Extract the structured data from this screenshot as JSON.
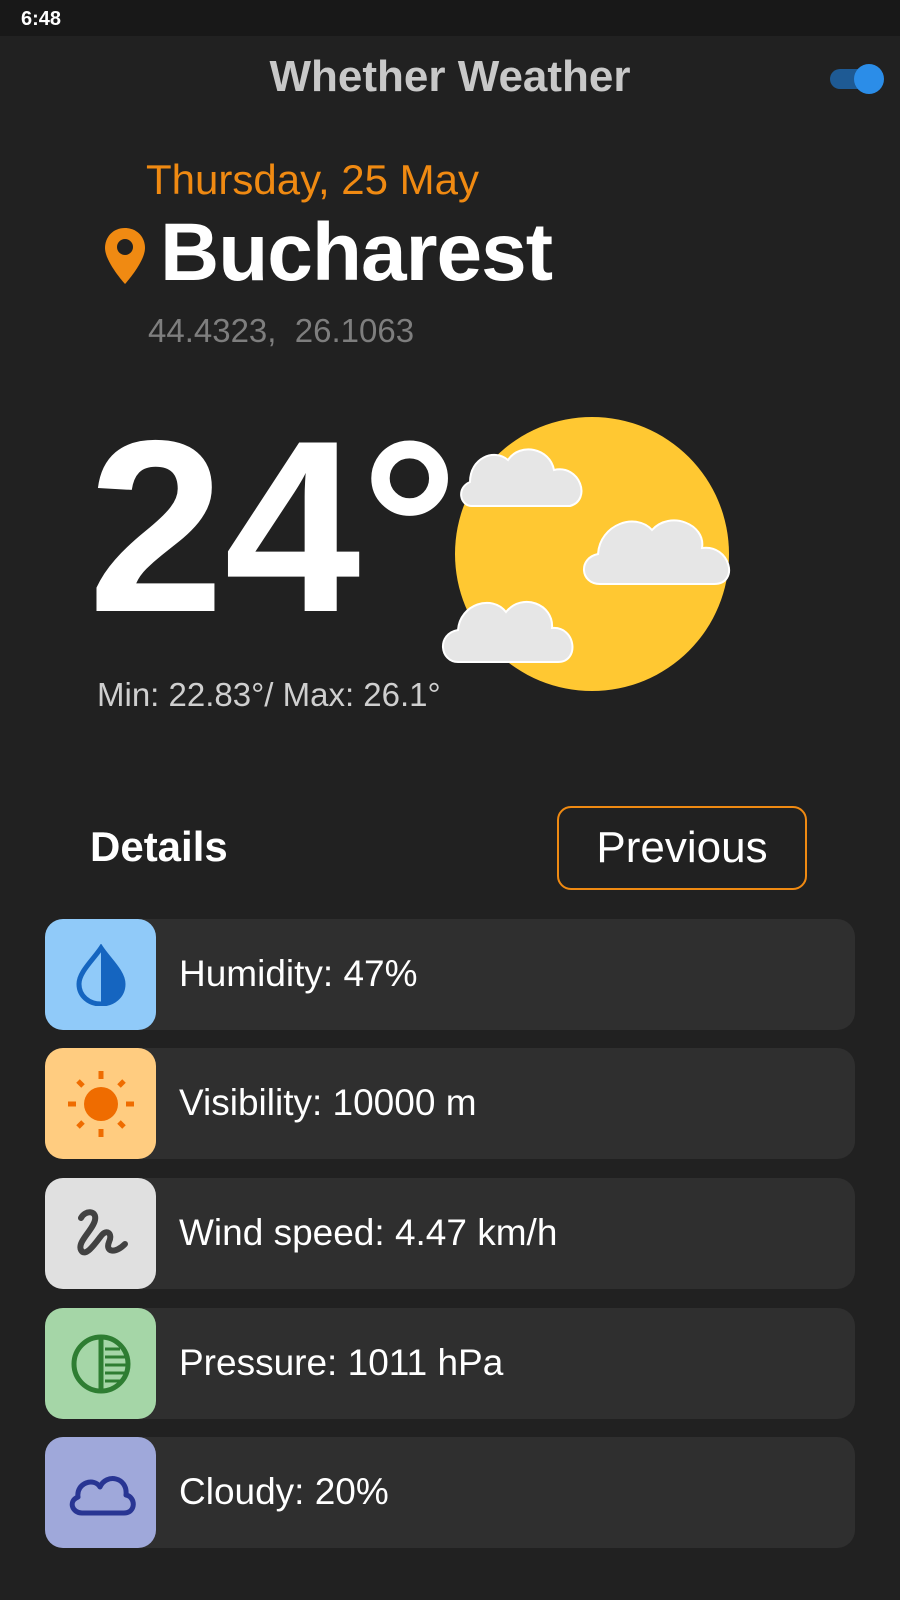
{
  "status_bar": {
    "time": "6:48"
  },
  "header": {
    "title": "Whether Weather",
    "toggle_on": true
  },
  "location": {
    "date": "Thursday, 25 May",
    "city": "Bucharest",
    "coordinates": "44.4323,  26.1063"
  },
  "current": {
    "temperature": "24°",
    "minmax": "Min: 22.83°/ Max: 26.1°",
    "condition_icon": "sun-with-clouds-icon"
  },
  "details": {
    "label": "Details",
    "previous_button": "Previous",
    "items": [
      {
        "label": "Humidity: 47%",
        "icon": "water-drop-icon",
        "icon_bg": "#90caf9",
        "icon_color": "#1565c0"
      },
      {
        "label": "Visibility: 10000 m",
        "icon": "sun-icon",
        "icon_bg": "#ffcc80",
        "icon_color": "#ef6c00"
      },
      {
        "label": "Wind speed: 4.47 km/h",
        "icon": "wind-squiggle-icon",
        "icon_bg": "#e0e0e0",
        "icon_color": "#424242"
      },
      {
        "label": "Pressure: 1011 hPa",
        "icon": "pressure-gauge-icon",
        "icon_bg": "#a5d6a7",
        "icon_color": "#2e7d32"
      },
      {
        "label": "Cloudy: 20%",
        "icon": "cloud-icon",
        "icon_bg": "#9fa8da",
        "icon_color": "#283593"
      }
    ]
  },
  "colors": {
    "background": "#212121",
    "accent_orange": "#f08a12",
    "card": "#2f2f2f",
    "sun": "#ffc832",
    "cloud": "#e6e6e6"
  }
}
